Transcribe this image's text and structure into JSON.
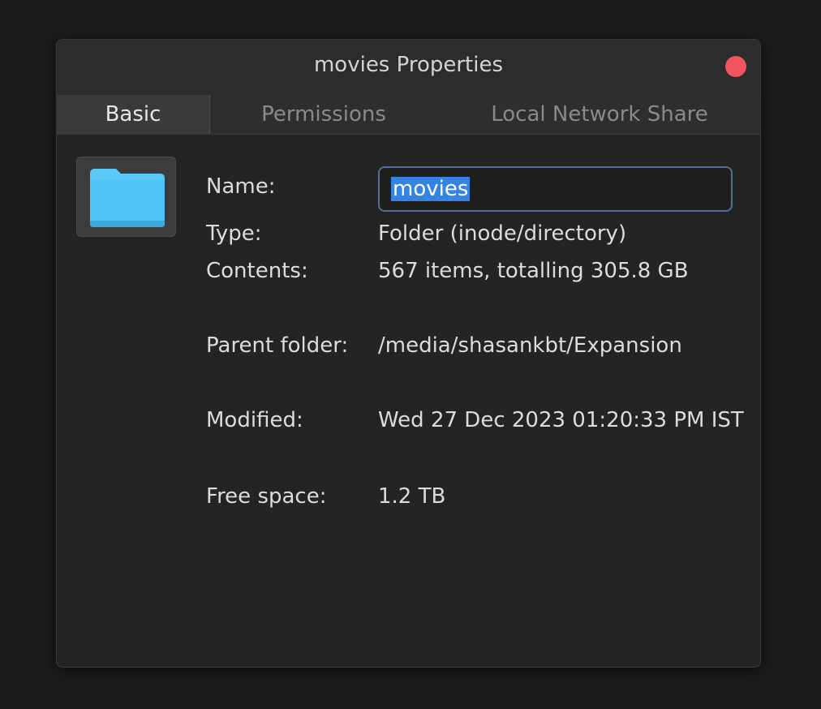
{
  "window": {
    "title": "movies Properties"
  },
  "tabs": [
    {
      "label": "Basic",
      "active": true
    },
    {
      "label": "Permissions",
      "active": false
    },
    {
      "label": "Local Network Share",
      "active": false
    }
  ],
  "icon": "folder-icon",
  "fields": {
    "name_label": "Name:",
    "name_value": "movies",
    "type_label": "Type:",
    "type_value": "Folder (inode/directory)",
    "contents_label": "Contents:",
    "contents_value": "567 items, totalling 305.8 GB",
    "parent_label": "Parent folder:",
    "parent_value": "/media/shasankbt/Expansion",
    "modified_label": "Modified:",
    "modified_value": "Wed 27 Dec 2023 01:20:33 PM IST",
    "free_label": "Free space:",
    "free_value": "1.2 TB"
  },
  "colors": {
    "accent": "#3584e4",
    "close": "#f0545c",
    "folder": "#4fc3f7"
  }
}
